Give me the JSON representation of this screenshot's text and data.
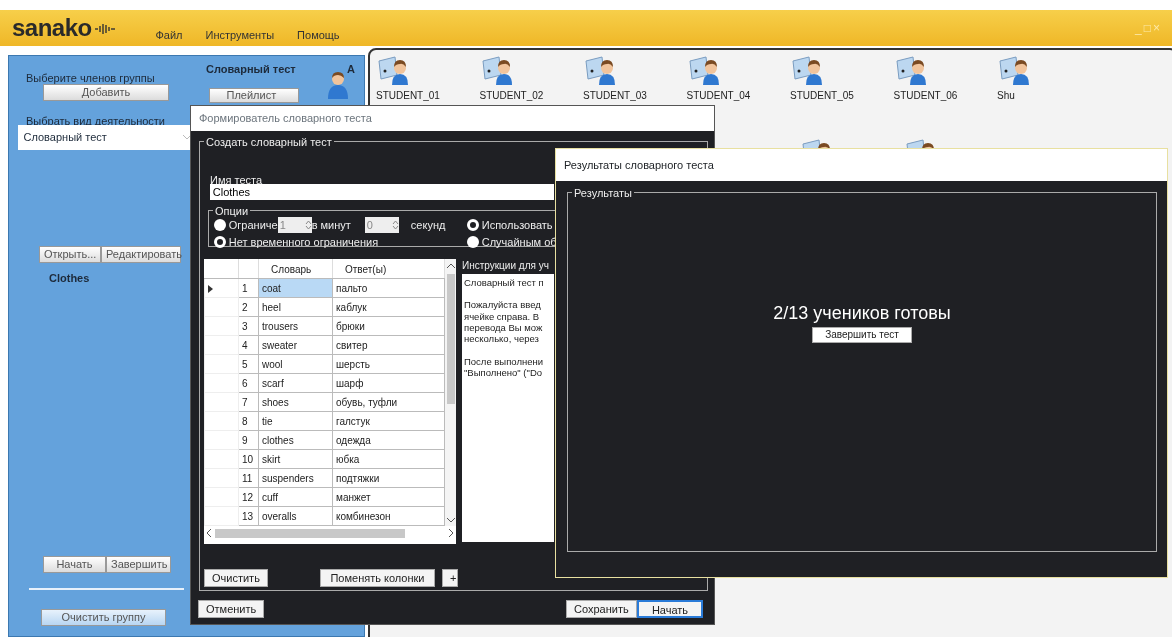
{
  "app": {
    "logo": "sanako",
    "menu": [
      "Файл",
      "Инструменты",
      "Помощь"
    ],
    "window_controls": [
      "_",
      "□",
      "×"
    ]
  },
  "group_panel": {
    "members_label": "Выберите членов группы",
    "add_button": "Добавить",
    "activity_label": "Выбрать вид деятельности",
    "activity_select": "Словарный тест",
    "open_button": "Открыть...",
    "edit_button": "Редактировать",
    "test_name": "Clothes",
    "start_button": "Начать",
    "finish_button": "Завершить",
    "clear_group_button": "Очистить группу"
  },
  "activity": {
    "title": "Словарный тест",
    "group_letter": "A",
    "playlist_button": "Плейлист"
  },
  "students": [
    {
      "name": "STUDENT_01"
    },
    {
      "name": "STUDENT_02"
    },
    {
      "name": "STUDENT_03"
    },
    {
      "name": "STUDENT_04"
    },
    {
      "name": "STUDENT_05"
    },
    {
      "name": "STUDENT_06"
    },
    {
      "name": "Shu"
    }
  ],
  "builder": {
    "title": "Формирователь словарного теста",
    "group_title": "Создать словарный тест",
    "name_label": "Имя теста",
    "name_value": "Clothes",
    "options_title": "Опции",
    "time_radios": [
      {
        "label": "Ограниче",
        "selected": false
      },
      {
        "label": "Нет временного ограничения",
        "selected": true
      }
    ],
    "minutes": "1",
    "minutes_label": "в минут",
    "seconds": "0",
    "seconds_label": "секунд",
    "order_radios": [
      {
        "label": "Использовать",
        "selected": true
      },
      {
        "label": "Случайным об",
        "selected": false
      }
    ],
    "table": {
      "columns": [
        "Словарь",
        "Ответ(ы)"
      ],
      "rows": [
        {
          "num": "1",
          "word": "coat",
          "answer": "пальто",
          "selected": true
        },
        {
          "num": "2",
          "word": "heel",
          "answer": "каблук",
          "selected": false
        },
        {
          "num": "3",
          "word": "trousers",
          "answer": "брюки",
          "selected": false
        },
        {
          "num": "4",
          "word": "sweater",
          "answer": "свитер",
          "selected": false
        },
        {
          "num": "5",
          "word": "wool",
          "answer": "шерсть",
          "selected": false
        },
        {
          "num": "6",
          "word": "scarf",
          "answer": "шарф",
          "selected": false
        },
        {
          "num": "7",
          "word": "shoes",
          "answer": "обувь, туфли",
          "selected": false
        },
        {
          "num": "8",
          "word": "tie",
          "answer": "галстук",
          "selected": false
        },
        {
          "num": "9",
          "word": "clothes",
          "answer": "одежда",
          "selected": false
        },
        {
          "num": "10",
          "word": "skirt",
          "answer": "юбка",
          "selected": false
        },
        {
          "num": "11",
          "word": "suspenders",
          "answer": "подтяжки",
          "selected": false
        },
        {
          "num": "12",
          "word": "cuff",
          "answer": "манжет",
          "selected": false
        },
        {
          "num": "13",
          "word": "overalls",
          "answer": "комбинезон",
          "selected": false
        }
      ]
    },
    "instructions_label": "Инструкции для уч",
    "instructions": [
      [
        "Словарный тест п"
      ],
      [
        "Пожалуйста введ",
        "ячейке справа. В",
        "перевода Вы мож",
        "несколько, через"
      ],
      [
        "После выполнени",
        "\"Выполнено\" (\"Do"
      ]
    ],
    "clear_button": "Очистить",
    "swap_button": "Поменять колонки",
    "add_row_button": "+",
    "cancel_button": "Отменить",
    "save_button": "Сохранить",
    "start_button": "Начать"
  },
  "results": {
    "title": "Результаты словарного теста",
    "group_title": "Результаты",
    "status": "2/13 учеников готовы",
    "finish_button": "Завершить тест"
  }
}
